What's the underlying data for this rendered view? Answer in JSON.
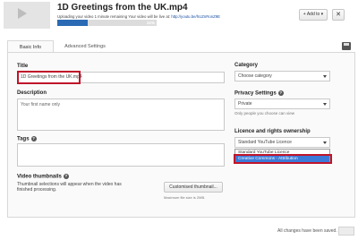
{
  "header": {
    "video_title": "1D Greetings from the UK.mp4",
    "status_text": "Uploading your video 1 minute remaining Your video will be live at: ",
    "video_url": "http://youtu.be/hUZnRonZ9E",
    "progress_label": "31%",
    "progress_fraction": 0.31,
    "add_to_label": "+ Add to ▾",
    "close_label": "✕"
  },
  "tabs": [
    {
      "label": "Basic Info",
      "active": true
    },
    {
      "label": "Advanced Settings",
      "active": false
    }
  ],
  "form": {
    "title_label": "Title",
    "title_value": "1D Greetings from the UK.mp4",
    "description_label": "Description",
    "description_value": "Your first name only",
    "tags_label": "Tags",
    "tags_help": "?",
    "thumbnails_label": "Video thumbnails",
    "thumbnails_help": "?",
    "thumbnails_text": "Thumbnail selections will appear when the video has finished processing.",
    "custom_thumb_button": "Customised thumbnail...",
    "custom_thumb_note": "Maximum file size is 2MB."
  },
  "sidebar": {
    "category_label": "Category",
    "category_value": "Choose category",
    "privacy_label": "Privacy Settings",
    "privacy_help": "?",
    "privacy_value": "Private",
    "privacy_note": "Only people you choose can view",
    "licence_label": "Licence and rights ownership",
    "licence_value": "Standard YouTube Licence",
    "licence_options": [
      "Standard YouTube Licence",
      "Creative Commons - Attribution"
    ],
    "selected_option_index": 1
  },
  "footer": {
    "saved_text": "All changes have been saved."
  },
  "colors": {
    "highlight": "#c0142a",
    "progress": "#2a6ab4",
    "selected_option": "#3b7ad8"
  }
}
